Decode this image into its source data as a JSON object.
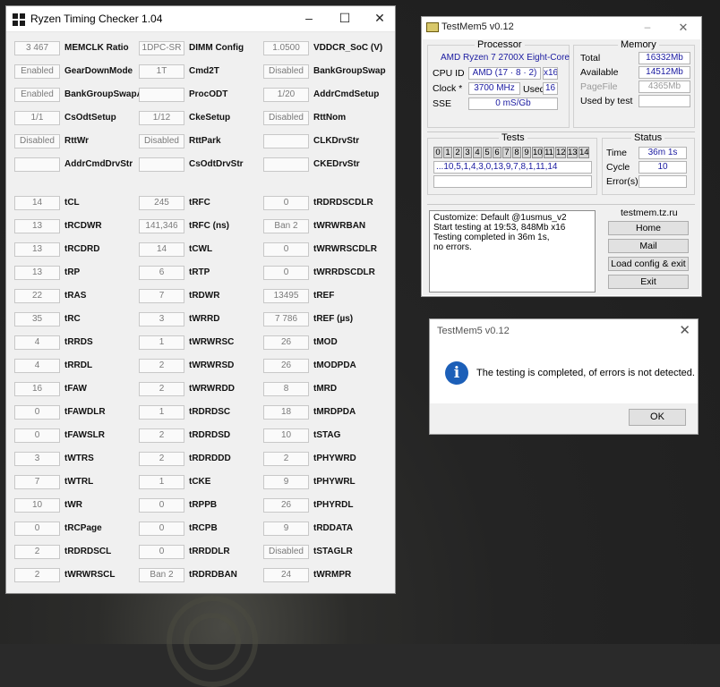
{
  "rtc": {
    "title": "Ryzen Timing Checker 1.04",
    "columns": [
      [
        {
          "value": "3 467",
          "label": "MEMCLK Ratio"
        },
        {
          "value": "Enabled",
          "label": "GearDownMode"
        },
        {
          "value": "Enabled",
          "label": "BankGroupSwapAlt"
        },
        {
          "value": "1/1",
          "label": "CsOdtSetup"
        },
        {
          "value": "Disabled",
          "label": "RttWr"
        },
        {
          "value": "",
          "label": "AddrCmdDrvStr"
        },
        {
          "value": "14",
          "label": "tCL"
        },
        {
          "value": "13",
          "label": "tRCDWR"
        },
        {
          "value": "13",
          "label": "tRCDRD"
        },
        {
          "value": "13",
          "label": "tRP"
        },
        {
          "value": "22",
          "label": "tRAS"
        },
        {
          "value": "35",
          "label": "tRC"
        },
        {
          "value": "4",
          "label": "tRRDS"
        },
        {
          "value": "4",
          "label": "tRRDL"
        },
        {
          "value": "16",
          "label": "tFAW"
        },
        {
          "value": "0",
          "label": "tFAWDLR"
        },
        {
          "value": "0",
          "label": "tFAWSLR"
        },
        {
          "value": "3",
          "label": "tWTRS"
        },
        {
          "value": "7",
          "label": "tWTRL"
        },
        {
          "value": "10",
          "label": "tWR"
        },
        {
          "value": "0",
          "label": "tRCPage"
        },
        {
          "value": "2",
          "label": "tRDRDSCL"
        },
        {
          "value": "2",
          "label": "tWRWRSCL"
        }
      ],
      [
        {
          "value": "1DPC-SR",
          "label": "DIMM Config"
        },
        {
          "value": "1T",
          "label": "Cmd2T"
        },
        {
          "value": "",
          "label": "ProcODT"
        },
        {
          "value": "1/12",
          "label": "CkeSetup"
        },
        {
          "value": "Disabled",
          "label": "RttPark"
        },
        {
          "value": "",
          "label": "CsOdtDrvStr"
        },
        {
          "value": "245",
          "label": "tRFC"
        },
        {
          "value": "141,346",
          "label": "tRFC (ns)"
        },
        {
          "value": "14",
          "label": "tCWL"
        },
        {
          "value": "6",
          "label": "tRTP"
        },
        {
          "value": "7",
          "label": "tRDWR"
        },
        {
          "value": "3",
          "label": "tWRRD"
        },
        {
          "value": "1",
          "label": "tWRWRSC"
        },
        {
          "value": "2",
          "label": "tWRWRSD"
        },
        {
          "value": "2",
          "label": "tWRWRDD"
        },
        {
          "value": "1",
          "label": "tRDRDSC"
        },
        {
          "value": "2",
          "label": "tRDRDSD"
        },
        {
          "value": "2",
          "label": "tRDRDDD"
        },
        {
          "value": "1",
          "label": "tCKE"
        },
        {
          "value": "0",
          "label": "tRPPB"
        },
        {
          "value": "0",
          "label": "tRCPB"
        },
        {
          "value": "0",
          "label": "tRRDDLR"
        },
        {
          "value": "Ban 2",
          "label": "tRDRDBAN"
        }
      ],
      [
        {
          "value": "1.0500",
          "label": "VDDCR_SoC (V)"
        },
        {
          "value": "Disabled",
          "label": "BankGroupSwap"
        },
        {
          "value": "1/20",
          "label": "AddrCmdSetup"
        },
        {
          "value": "Disabled",
          "label": "RttNom"
        },
        {
          "value": "",
          "label": "CLKDrvStr"
        },
        {
          "value": "",
          "label": "CKEDrvStr"
        },
        {
          "value": "0",
          "label": "tRDRDSCDLR"
        },
        {
          "value": "Ban 2",
          "label": "tWRWRBAN"
        },
        {
          "value": "0",
          "label": "tWRWRSCDLR"
        },
        {
          "value": "0",
          "label": "tWRRDSCDLR"
        },
        {
          "value": "13495",
          "label": "tREF"
        },
        {
          "value": "7 786",
          "label": "tREF (µs)"
        },
        {
          "value": "26",
          "label": "tMOD"
        },
        {
          "value": "26",
          "label": "tMODPDA"
        },
        {
          "value": "8",
          "label": "tMRD"
        },
        {
          "value": "18",
          "label": "tMRDPDA"
        },
        {
          "value": "10",
          "label": "tSTAG"
        },
        {
          "value": "2",
          "label": "tPHYWRD"
        },
        {
          "value": "9",
          "label": "tPHYWRL"
        },
        {
          "value": "26",
          "label": "tPHYRDL"
        },
        {
          "value": "9",
          "label": "tRDDATA"
        },
        {
          "value": "Disabled",
          "label": "tSTAGLR"
        },
        {
          "value": "24",
          "label": "tWRMPR"
        }
      ]
    ]
  },
  "testmem": {
    "title": "TestMem5 v0.12",
    "processor": {
      "caption": "Processor",
      "name": "AMD Ryzen 7 2700X Eight-Core",
      "cpuid_label": "CPU ID",
      "cpuid_value": "AMD  (17 · 8 · 2)",
      "cpuid_threads": "x16",
      "clock_label": "Clock *",
      "clock_value": "3700 MHz",
      "used_label": "Used",
      "used_value": "16",
      "sse_label": "SSE",
      "sse_value": "0 mS/Gb"
    },
    "memory": {
      "caption": "Memory",
      "total_label": "Total",
      "total_value": "16332Mb",
      "available_label": "Available",
      "available_value": "14512Mb",
      "pagefile_label": "PageFile",
      "pagefile_value": "4365Mb",
      "usedbytest_label": "Used by test",
      "usedbytest_value": ""
    },
    "tests": {
      "caption": "Tests",
      "numbers": [
        "0",
        "1",
        "2",
        "3",
        "4",
        "5",
        "6",
        "7",
        "8",
        "9",
        "10",
        "11",
        "12",
        "13",
        "14"
      ],
      "sequence": "...10,5,1,4,3,0,13,9,7,8,1,11,14",
      "progress": ""
    },
    "status": {
      "caption": "Status",
      "time_label": "Time",
      "time_value": "36m 1s",
      "cycle_label": "Cycle",
      "cycle_value": "10",
      "errors_label": "Error(s)",
      "errors_value": ""
    },
    "log": {
      "lines": [
        "Customize: Default @1usmus_v2",
        "Start testing at 19:53, 848Mb x16",
        "Testing completed in 36m 1s,",
        "no errors."
      ]
    },
    "site": {
      "caption": "testmem.tz.ru",
      "home": "Home",
      "mail": "Mail",
      "load": "Load config & exit",
      "exit": "Exit"
    }
  },
  "dialog": {
    "title": "TestMem5 v0.12",
    "message": "The testing is completed, of errors is not detected.",
    "ok": "OK"
  }
}
